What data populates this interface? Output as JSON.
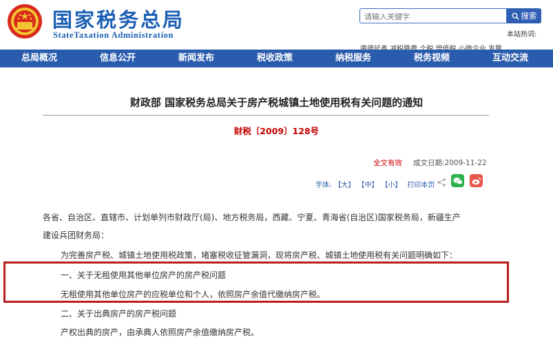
{
  "header": {
    "logo_cn": "国家税务总局",
    "logo_en": "StateTaxation Administration",
    "search_placeholder": "请输入关键字",
    "search_button": "搜索",
    "hot_label": "本站热词:",
    "hot_items": "康德延鑫 减税降费 个税 增值税 小微企业 发票"
  },
  "nav": {
    "items": [
      "总局概况",
      "信息公开",
      "新闻发布",
      "税收政策",
      "纳税服务",
      "税务视频",
      "互动交流"
    ]
  },
  "article": {
    "title": "财政部 国家税务总局关于房产税城镇土地使用税有关问题的通知",
    "doc_number": "财税〔2009〕128号",
    "validity": "全文有效",
    "date": "成文日期:2009-11-22",
    "font_label": "字体:",
    "font_large": "【大】",
    "font_medium": "【中】",
    "font_small": "【小】",
    "print": "打印本页",
    "p1_line1": "各省、自治区、直辖市、计划单列市财政厅(局)、地方税务局，西藏、宁夏、青海省(自治区)国家税务局，新疆生产",
    "p1_line2": "建设兵团财务局：",
    "p2": "为完善房产税、城镇土地使用税政策，堵塞税收征管漏洞，现将房产税、城镇土地使用税有关问题明确如下：",
    "s1_title": "一、关于无租使用其他单位房产的房产税问题",
    "s1_body": "无租使用其他单位房产的应税单位和个人，依照房产余值代缴纳房产税。",
    "s2_title": "二、关于出典房产的房产税问题",
    "s2_body": "产权出典的房产，由承典人依照房产余值缴纳房产税。"
  },
  "colors": {
    "brand_blue": "#2a5cad",
    "highlight_red": "#b81c1c",
    "doc_number_red": "#c40000"
  }
}
